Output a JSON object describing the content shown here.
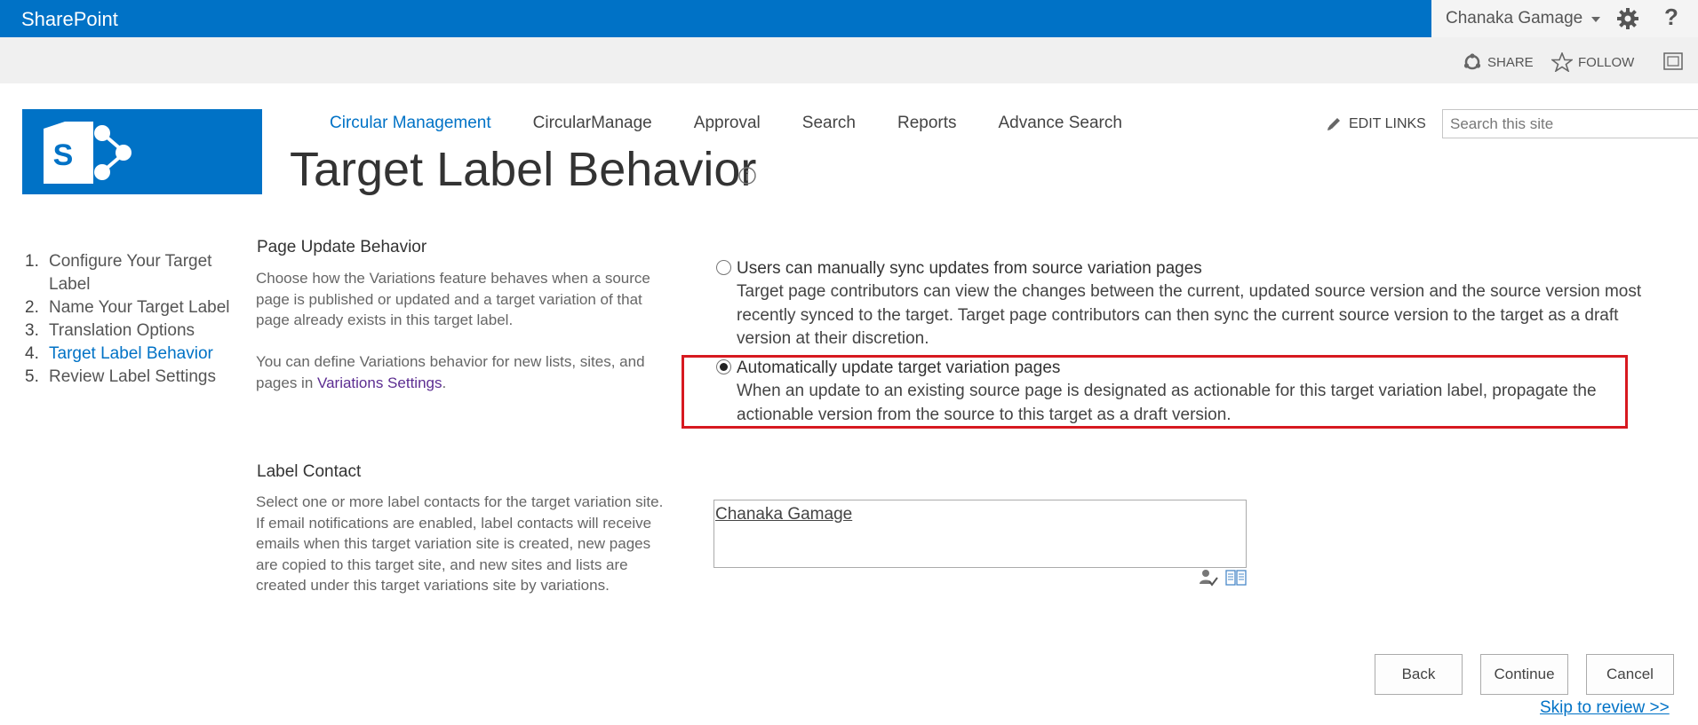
{
  "suitebar": {
    "brand": "SharePoint",
    "user_name": "Chanaka Gamage",
    "help_label": "?"
  },
  "actionbar": {
    "share_label": "SHARE",
    "follow_label": "FOLLOW"
  },
  "topnav": {
    "items": [
      {
        "label": "Circular Management",
        "active": true
      },
      {
        "label": "CircularManage"
      },
      {
        "label": "Approval"
      },
      {
        "label": "Search"
      },
      {
        "label": "Reports"
      },
      {
        "label": "Advance Search"
      }
    ],
    "edit_links": "EDIT LINKS",
    "search_placeholder": "Search this site"
  },
  "page": {
    "title": "Target Label Behavior"
  },
  "steps": [
    {
      "num": "1.",
      "label": "Configure Your Target Label"
    },
    {
      "num": "2.",
      "label": "Name Your Target Label"
    },
    {
      "num": "3.",
      "label": "Translation Options"
    },
    {
      "num": "4.",
      "label": "Target Label Behavior",
      "current": true
    },
    {
      "num": "5.",
      "label": "Review Label Settings"
    }
  ],
  "page_update": {
    "title": "Page Update Behavior",
    "desc1": "Choose how the Variations feature behaves when a source page is published or updated and a target variation of that page already exists in this target label.",
    "desc2_prefix": "You can define Variations behavior for new lists, sites, and pages in ",
    "desc2_link": "Variations Settings",
    "desc2_suffix": ".",
    "options": [
      {
        "label": "Users can manually sync updates from source variation pages",
        "desc": "Target page contributors can view the changes between the current, updated source version and the source version most recently synced to the target. Target page contributors can then sync the current source version to the target as a draft version at their discretion.",
        "checked": false
      },
      {
        "label": "Automatically update target variation pages",
        "desc": "When an update to an existing source page is designated as actionable for this target variation label, propagate the actionable version from the source to this target as a draft version.",
        "checked": true
      }
    ]
  },
  "label_contact": {
    "title": "Label Contact",
    "desc": "Select one or more label contacts for the target variation site. If email notifications are enabled, label contacts will receive emails when this target variation site is created, new pages are copied to this target site, and new sites and lists are created under this target variations site by variations.",
    "value": "Chanaka Gamage"
  },
  "buttons": {
    "back": "Back",
    "continue": "Continue",
    "cancel": "Cancel"
  },
  "skip_link": "Skip to review >>",
  "colors": {
    "brand_blue": "#0072c6",
    "highlight_red": "#d71920",
    "link_purple": "#5c2d91"
  }
}
